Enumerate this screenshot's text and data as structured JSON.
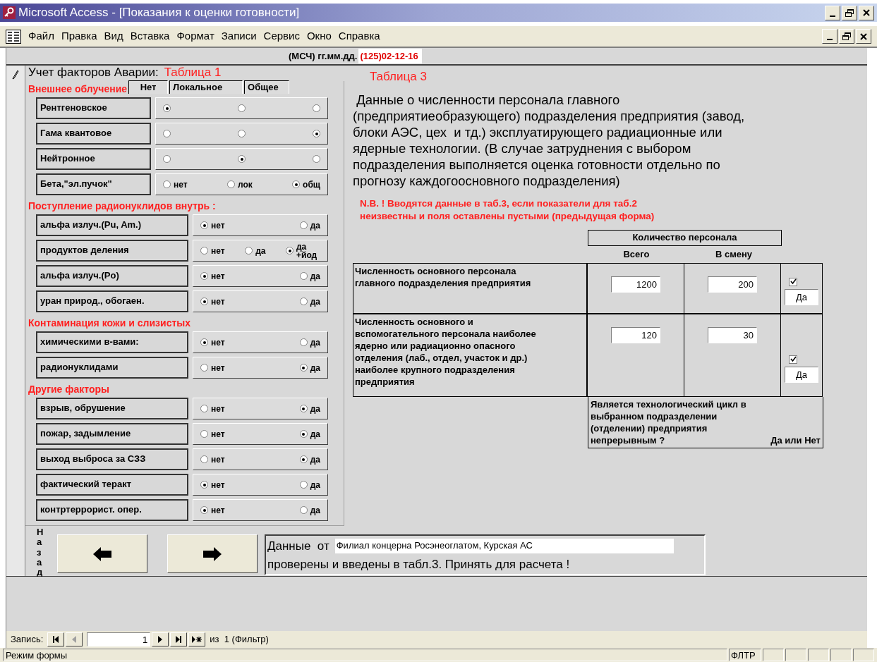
{
  "window": {
    "title": "Microsoft Access - [Показания к оценки готовности]"
  },
  "menu": [
    "Файл",
    "Правка",
    "Вид",
    "Вставка",
    "Формат",
    "Записи",
    "Сервис",
    "Окно",
    "Справка"
  ],
  "header": {
    "label": "(МСЧ) гг.мм.дд.",
    "value": "(125)02-12-16"
  },
  "left": {
    "title": "Учет  факторов Аварии:",
    "table_label": "Таблица 1",
    "sections": [
      {
        "title": "Внешнее облучение",
        "kind": "three-way",
        "columns": [
          "Нет",
          "Локальное",
          "Общее"
        ],
        "rows": [
          {
            "label": "Рентгеновское",
            "options": [
              {
                "selected": true
              },
              {
                "selected": false
              },
              {
                "selected": false
              }
            ]
          },
          {
            "label": "Гама квантовое",
            "options": [
              {
                "selected": false
              },
              {
                "selected": false
              },
              {
                "selected": true
              }
            ]
          },
          {
            "label": "Нейтронное",
            "options": [
              {
                "selected": false
              },
              {
                "selected": true
              },
              {
                "selected": false
              }
            ]
          },
          {
            "label": "Бета,\"эл.пучок\"",
            "options": [
              {
                "label": "нет",
                "selected": false
              },
              {
                "label": "лок",
                "selected": false
              },
              {
                "label": "общ",
                "selected": true
              }
            ]
          }
        ]
      },
      {
        "title": "Поступление радионуклидов внутрь :",
        "kind": "two-way",
        "rows": [
          {
            "label": "альфа излуч.(Pu, Am.)",
            "options": [
              {
                "label": "нет",
                "selected": true
              },
              {
                "label": "да",
                "selected": false
              }
            ]
          },
          {
            "label": "продуктов деления",
            "options": [
              {
                "label": "нет",
                "selected": false
              },
              {
                "label": "да",
                "selected": false
              },
              {
                "label": "да +йод",
                "selected": true
              }
            ]
          },
          {
            "label": "альфа излуч.(Po)",
            "options": [
              {
                "label": "нет",
                "selected": true
              },
              {
                "label": "да",
                "selected": false
              }
            ]
          },
          {
            "label": "уран природ., обогаен.",
            "options": [
              {
                "label": "нет",
                "selected": true
              },
              {
                "label": "да",
                "selected": false
              }
            ]
          }
        ]
      },
      {
        "title": "Контаминация кожи и слизистых",
        "kind": "two-way",
        "rows": [
          {
            "label": "химическими в-вами:",
            "options": [
              {
                "label": "нет",
                "selected": true
              },
              {
                "label": "да",
                "selected": false
              }
            ]
          },
          {
            "label": "радионуклидами",
            "options": [
              {
                "label": "нет",
                "selected": false
              },
              {
                "label": "да",
                "selected": true
              }
            ]
          }
        ]
      },
      {
        "title": "Другие факторы",
        "kind": "two-way",
        "rows": [
          {
            "label": "взрыв, обрушение",
            "options": [
              {
                "label": "нет",
                "selected": false
              },
              {
                "label": "да",
                "selected": true
              }
            ]
          },
          {
            "label": "пожар, задымление",
            "options": [
              {
                "label": "нет",
                "selected": false
              },
              {
                "label": "да",
                "selected": true
              }
            ]
          },
          {
            "label": "выход выброса за СЗЗ",
            "options": [
              {
                "label": "нет",
                "selected": false
              },
              {
                "label": "да",
                "selected": true
              }
            ]
          },
          {
            "label": "фактический теракт",
            "options": [
              {
                "label": "нет",
                "selected": true
              },
              {
                "label": "да",
                "selected": false
              }
            ]
          },
          {
            "label": "контртеррорист. опер.",
            "options": [
              {
                "label": "нет",
                "selected": true
              },
              {
                "label": "да",
                "selected": false
              }
            ]
          }
        ]
      }
    ]
  },
  "right": {
    "table_label": "Таблица 3",
    "description_lines": [
      " Данные о численности персонала главного",
      "(предприятиеобразующего) подразделения предприятия (завод,",
      "блоки АЭС, цех  и тд.) эксплуатирующего радиационные или",
      "ядерные технологии. (В случае затруднения с выбором",
      "подразделения выполняется оценка готовности отдельно по",
      "прогнозу каждогоосновного подразделения)"
    ],
    "note_lines": [
      "N.B. ! Вводятся данные в таб.3, если показатели для таб.2",
      "неизвестны и поля оставлены пустыми (предыдущая форма)"
    ],
    "table": {
      "group_header": "Количество персонала",
      "columns": [
        "Всего",
        "В смену"
      ],
      "rows": [
        {
          "label": "Численность основного персонала главного подразделения предприятия",
          "total": "1200",
          "shift": "200",
          "checked": true,
          "answer": "Да"
        },
        {
          "label": "Численность основного и вспомогательного персонала наиболее ядерно или радиационно опасного отделения (лаб., отдел, участок и др.) наиболее крупного подразделения предприятия",
          "total": "120",
          "shift": "30",
          "checked": true,
          "answer": "Да"
        }
      ],
      "footer": "Является технологический цикл в выбранном подразделении (отделении) предприятия непрерывным ?",
      "footer_hint": "Да или Нет"
    }
  },
  "bottom": {
    "back_label": "Назад",
    "source_label": "Данные  от",
    "source_value": "Филиал концерна Росэнеоглатом, Курская АС",
    "confirmation": "проверены и введены в табл.3. Принять для расчета !"
  },
  "navigator": {
    "label": "Запись:",
    "record": "1",
    "total": "из  1 (Фильтр)"
  },
  "status_bar": {
    "mode": "Режим формы",
    "indicators": [
      "ФЛТР"
    ]
  }
}
